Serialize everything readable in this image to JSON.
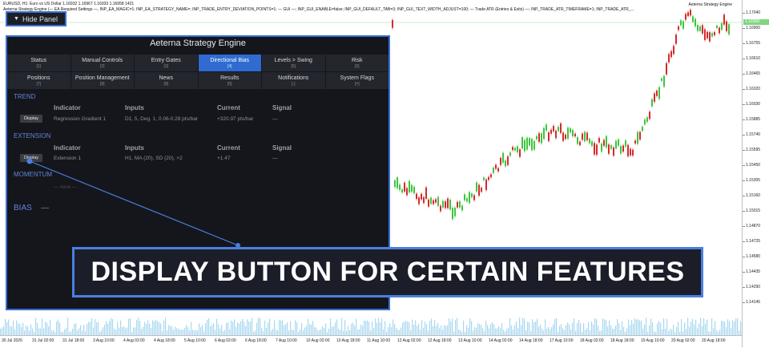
{
  "chart": {
    "info_line_1": "EURUSD, H1:  Euro vs US Dollar  1.16932 1.16967 1.16933 1.16958  1421",
    "info_line_2": "Aeterna Strategy Engine (— EA Required Settings —, INP_EA_MAGIC=1; INP_EA_STRATEGY_NAME=; INP_TRADE_ENTRY_DEVIATION_POINTS=1; — GUI —; INP_GUI_ENABLE=false; INP_GUI_DEFAULT_TAB=3; INP_GUI_TEXT_WIDTH_ADJUST=100; — Trade ATR (Entries & Exits) —; INP_TRADE_ATR_TIMEFRAME=1; INP_TRADE_ATR_...",
    "ea_name": "Aeterna Strategy Engine",
    "price_labels": [
      "1.17040",
      "1.16900",
      "1.16755",
      "1.16610",
      "1.16465",
      "1.16320",
      "1.16030",
      "1.15885",
      "1.15740",
      "1.15595",
      "1.15450",
      "1.15305",
      "1.15160",
      "1.15015",
      "1.14870",
      "1.14725",
      "1.14580",
      "1.14435",
      "1.14290",
      "1.14145"
    ],
    "current_price": "1.16958",
    "time_labels": [
      "30 Jul 2026",
      "31 Jul 02:00",
      "31 Jul 18:00",
      "3 Aug 10:00",
      "4 Aug 02:00",
      "4 Aug 18:00",
      "5 Aug 10:00",
      "6 Aug 02:00",
      "6 Aug 18:00",
      "7 Aug 10:00",
      "10 Aug 02:00",
      "10 Aug 18:00",
      "11 Aug 10:00",
      "12 Aug 02:00",
      "12 Aug 18:00",
      "13 Aug 10:00",
      "14 Aug 02:00",
      "14 Aug 18:00",
      "17 Aug 10:00",
      "18 Aug 02:00",
      "18 Aug 18:00",
      "19 Aug 10:00",
      "20 Aug 02:00",
      "20 Aug 18:00"
    ],
    "up_color": "#3ec43e",
    "down_color": "#d42a2a"
  },
  "hide_panel": {
    "label": "Hide Panel",
    "icon": "triangle-down-icon"
  },
  "panel": {
    "title": "Aeterna Strategy Engine",
    "tabs_row1": [
      {
        "label": "Status",
        "num": "[1]"
      },
      {
        "label": "Manual Controls",
        "num": "[2]"
      },
      {
        "label": "Entry Gates",
        "num": "[3]"
      },
      {
        "label": "Directional Bias",
        "num": "[4]"
      },
      {
        "label": "Levels > Swing",
        "num": "[5]"
      },
      {
        "label": "Risk",
        "num": "[6]"
      }
    ],
    "tabs_row2": [
      {
        "label": "Positions",
        "num": "[7]"
      },
      {
        "label": "Position Management",
        "num": "[8]"
      },
      {
        "label": "News",
        "num": "[9]"
      },
      {
        "label": "Results",
        "num": "[0]"
      },
      {
        "label": "Notifications",
        "num": "[-]"
      },
      {
        "label": "System Flags",
        "num": "[=]"
      }
    ],
    "trend": {
      "title": "TREND",
      "headers": {
        "indicator": "Indicator",
        "inputs": "Inputs",
        "current": "Current",
        "signal": "Signal"
      },
      "row": {
        "button": "Display",
        "indicator": "Regression Gradient 1",
        "inputs": "D1, 5, Deg. 1, 0.06-0.28 pts/bar",
        "current": "+320.97 pts/bar",
        "signal": "—"
      }
    },
    "extension": {
      "title": "EXTENSION",
      "headers": {
        "indicator": "Indicator",
        "inputs": "Inputs",
        "current": "Current",
        "signal": "Signal"
      },
      "row": {
        "button": "Display",
        "indicator": "Extension 1",
        "inputs": "H1, MA (20), SD (20), >2",
        "current": "+1.47",
        "signal": "—"
      }
    },
    "momentum": {
      "title": "MOMENTUM",
      "none": "— none —"
    },
    "bias": {
      "label": "BIAS",
      "value": "—"
    }
  },
  "callout": {
    "text": "DISPLAY BUTTON FOR CERTAIN FEATURES"
  }
}
